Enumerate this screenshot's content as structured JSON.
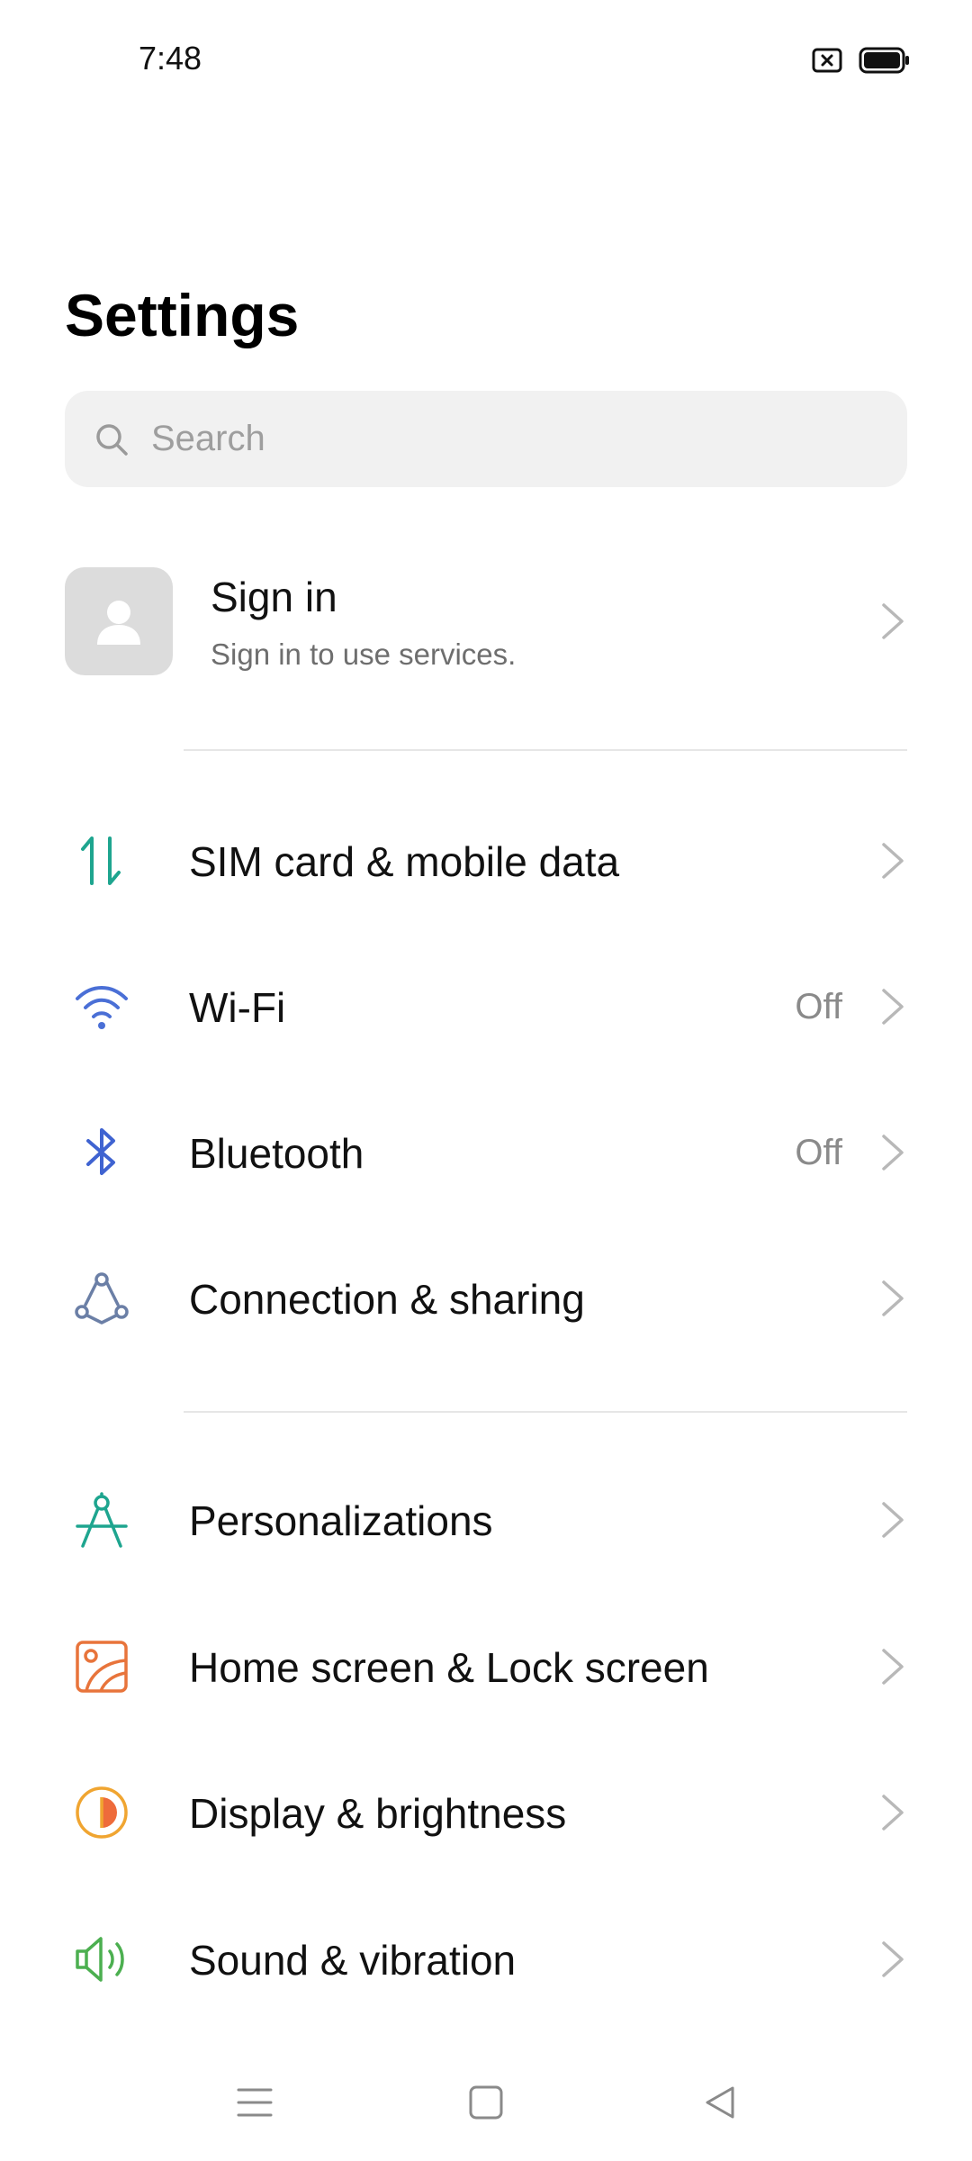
{
  "status_bar": {
    "time": "7:48",
    "icons": [
      "close-box-icon",
      "battery-full-icon"
    ]
  },
  "page": {
    "title": "Settings"
  },
  "search": {
    "placeholder": "Search",
    "icon": "search-icon"
  },
  "account": {
    "title": "Sign in",
    "subtitle": "Sign in to use services.",
    "icon": "person-icon"
  },
  "groups": [
    {
      "items": [
        {
          "label": "SIM card & mobile data",
          "value": "",
          "icon": "mobile-data-icon",
          "color": "#1ea58f"
        },
        {
          "label": "Wi-Fi",
          "value": "Off",
          "icon": "wifi-icon",
          "color": "#4a6fd6"
        },
        {
          "label": "Bluetooth",
          "value": "Off",
          "icon": "bluetooth-icon",
          "color": "#3f63d1"
        },
        {
          "label": "Connection & sharing",
          "value": "",
          "icon": "connection-icon",
          "color": "#6b7fa6"
        }
      ]
    },
    {
      "items": [
        {
          "label": "Personalizations",
          "value": "",
          "icon": "compass-icon",
          "color": "#1ea58f"
        },
        {
          "label": "Home screen & Lock screen",
          "value": "",
          "icon": "wallpaper-icon",
          "color": "#e8743b"
        },
        {
          "label": "Display & brightness",
          "value": "",
          "icon": "brightness-icon",
          "color": "#f0a531"
        },
        {
          "label": "Sound & vibration",
          "value": "",
          "icon": "speaker-icon",
          "color": "#4caf50"
        }
      ]
    }
  ],
  "nav_bar": {
    "icons": [
      "menu-icon",
      "home-icon",
      "back-icon"
    ]
  }
}
